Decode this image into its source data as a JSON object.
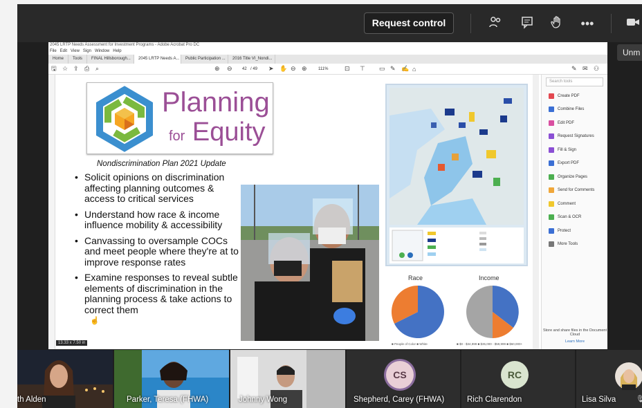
{
  "teams": {
    "request_control": "Request control",
    "tooltip": "Unm",
    "icons": [
      "people-icon",
      "chat-icon",
      "raise-hand-icon",
      "more-icon",
      "camera-icon"
    ]
  },
  "acrobat": {
    "window_title": "2045 LRTP Needs Assessment for Investment Programs - Adobe Acrobat Pro DC",
    "menu": [
      "File",
      "Edit",
      "View",
      "Sign",
      "Window",
      "Help"
    ],
    "tabs": [
      "Home",
      "Tools",
      "FINAL Hillsborough...",
      "2045 LRTP Needs A...",
      "Public Participation ...",
      "2016 Title VI_Nondi..."
    ],
    "page_num": "42",
    "page_total": "/ 49",
    "zoom": "111%",
    "search_placeholder": "Search tools",
    "tools": [
      "Create PDF",
      "Combine Files",
      "Edit PDF",
      "Request Signatures",
      "Fill & Sign",
      "Export PDF",
      "Organize Pages",
      "Send for Comments",
      "Comment",
      "Scan & OCR",
      "Protect",
      "More Tools"
    ],
    "cloud_text": "Store and share files in the Document Cloud",
    "learn_more": "Learn More",
    "page_size": "13.33 x 7.50 in"
  },
  "slide": {
    "logo_line1": "Planning",
    "logo_for": "for",
    "logo_line2": "Equity",
    "subtitle": "Nondiscrimination Plan 2021 Update",
    "bullets": [
      "Solicit opinions on discrimination affecting planning outcomes & access to critical services",
      "Understand how race & income influence mobility & accessibility",
      "Canvassing to oversample COCs and meet people where they're at to improve response rates",
      "Examine responses to reveal subtle elements of discrimination in the planning process & take actions to correct them"
    ],
    "race_title": "Race",
    "income_title": "Income",
    "race_legend": "■ People of Color  ■ White",
    "income_legend": "■ $0 - $34,999  ■ $35,000 - $59,999  ■ $60,000+"
  },
  "participants": [
    {
      "name": "th Alden"
    },
    {
      "name": "Parker, Teresa (FHWA)"
    },
    {
      "name": "Johnny Wong"
    },
    {
      "name": "Shepherd, Carey (FHWA)",
      "initials": "CS"
    },
    {
      "name": "Rich Clarendon",
      "initials": "RC"
    },
    {
      "name": "Lisa Silva"
    }
  ]
}
